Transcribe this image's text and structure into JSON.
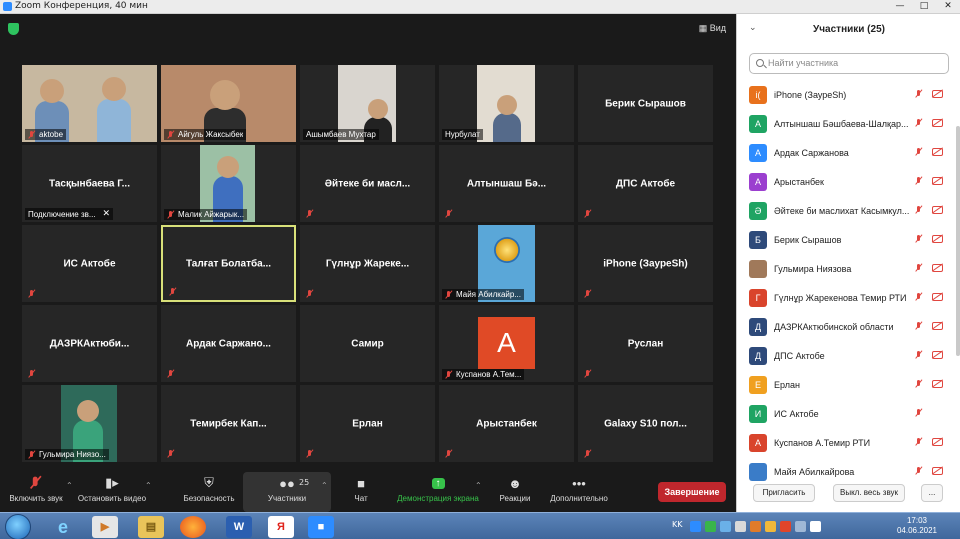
{
  "window": {
    "title": "Zoom Конференция, 40 мин",
    "view_label": "Вид"
  },
  "tiles": [
    {
      "name": "aktobe",
      "label": "aktobe",
      "photo": true,
      "muted": true
    },
    {
      "name": "Айгуль Жаксыбек",
      "label": "Айгуль Жаксыбек",
      "photo": true,
      "muted": true
    },
    {
      "name": "Ашымбаев Мухтар",
      "label": "Ашымбаев Мухтар",
      "photo": true,
      "muted": false
    },
    {
      "name": "Нурбулат",
      "label": "Нурбулат",
      "photo": true,
      "muted": false
    },
    {
      "name": "Берик Сырашов",
      "label": "",
      "photo": false,
      "muted": false
    },
    {
      "name": "Тасқынбаева Г...",
      "label": "Подключение зв...",
      "photo": false,
      "muted": false,
      "close": true
    },
    {
      "name": "Малик Айжарык...",
      "label": "Малик Айжарык...",
      "photo": true,
      "muted": true
    },
    {
      "name": "Әйтеке би масл...",
      "label": "",
      "photo": false,
      "muted": true
    },
    {
      "name": "Алтыншаш Бә...",
      "label": "",
      "photo": false,
      "muted": true
    },
    {
      "name": "ДПС Актобе",
      "label": "",
      "photo": false,
      "muted": true
    },
    {
      "name": "ИС Актобе",
      "label": "",
      "photo": false,
      "muted": true
    },
    {
      "name": "Талғат Болатба...",
      "label": "",
      "photo": false,
      "muted": true,
      "active": true
    },
    {
      "name": "Гүлнұр Жареке...",
      "label": "",
      "photo": false,
      "muted": true
    },
    {
      "name": "Майя Абилкайр...",
      "label": "Майя Абилкайр...",
      "photo": true,
      "muted": true
    },
    {
      "name": "iPhone (ЗаурeSh)",
      "label": "",
      "photo": false,
      "muted": true
    },
    {
      "name": "ДАЗРКАктюби...",
      "label": "",
      "photo": false,
      "muted": true
    },
    {
      "name": "Ардак Саржано...",
      "label": "",
      "photo": false,
      "muted": true
    },
    {
      "name": "Самир",
      "label": "",
      "photo": false,
      "muted": false
    },
    {
      "name": "Куспанов А.Тем...",
      "label": "Куспанов А.Тем...",
      "photo": false,
      "avatar": "A",
      "muted": true
    },
    {
      "name": "Руслан",
      "label": "",
      "photo": false,
      "muted": true
    },
    {
      "name": "Гульмира Ниязо...",
      "label": "Гульмира Ниязо...",
      "photo": true,
      "muted": true
    },
    {
      "name": "Темирбек Кап...",
      "label": "",
      "photo": false,
      "muted": true
    },
    {
      "name": "Ерлан",
      "label": "",
      "photo": false,
      "muted": true
    },
    {
      "name": "Арыстанбек",
      "label": "",
      "photo": false,
      "muted": true
    },
    {
      "name": "Galaxy S10 пол...",
      "label": "",
      "photo": false,
      "muted": true
    }
  ],
  "toolbar": {
    "unmute": "Включить звук",
    "video": "Остановить видео",
    "security": "Безопасность",
    "participants": "Участники",
    "participants_count": "25",
    "chat": "Чат",
    "share": "Демонстрация экрана",
    "reactions": "Реакции",
    "more": "Дополнительно",
    "end": "Завершение"
  },
  "panel": {
    "title": "Участники (25)",
    "search_placeholder": "Найти участника",
    "participants": [
      {
        "initial": "i(",
        "name": "iPhone (ЗаурeSh)",
        "color": "#e8711c",
        "cam_off": true
      },
      {
        "initial": "A",
        "name": "Алтыншаш Бәшбаева-Шалқар...",
        "color": "#1fa463",
        "cam_off": true
      },
      {
        "initial": "A",
        "name": "Ардак Саржанова",
        "color": "#2d8cff",
        "cam_off": true
      },
      {
        "initial": "A",
        "name": "Арыстанбек",
        "color": "#9b3fcf",
        "cam_off": true
      },
      {
        "initial": "Ә",
        "name": "Әйтеке би маслихат Касымкул...",
        "color": "#1fa463",
        "cam_off": true
      },
      {
        "initial": "Б",
        "name": "Берик Сырашов",
        "color": "#2e4a7a",
        "cam_off": true
      },
      {
        "initial": "",
        "name": "Гульмира Ниязова",
        "color": "#a0795a",
        "cam_off": true
      },
      {
        "initial": "Г",
        "name": "Гүлнұр Жарекенова Темир РТИ",
        "color": "#d9442c",
        "cam_off": true
      },
      {
        "initial": "Д",
        "name": "ДАЗРКАктюбинской области",
        "color": "#2e4a7a",
        "cam_off": true
      },
      {
        "initial": "Д",
        "name": "ДПС Актобе",
        "color": "#2e4a7a",
        "cam_off": true
      },
      {
        "initial": "E",
        "name": "Ерлан",
        "color": "#f0a020",
        "cam_off": true
      },
      {
        "initial": "И",
        "name": "ИС Актобе",
        "color": "#1fa463",
        "cam_off": false
      },
      {
        "initial": "A",
        "name": "Куспанов А.Темир РТИ",
        "color": "#d9442c",
        "cam_off": true
      },
      {
        "initial": "",
        "name": "Майя Абилкайрова",
        "color": "#3a7cc8",
        "cam_off": true
      }
    ],
    "invite": "Пригласить",
    "mute_all": "Выкл. весь звук",
    "more": "..."
  },
  "taskbar": {
    "lang": "KK",
    "time": "17:03",
    "date": "04.06.2021"
  }
}
